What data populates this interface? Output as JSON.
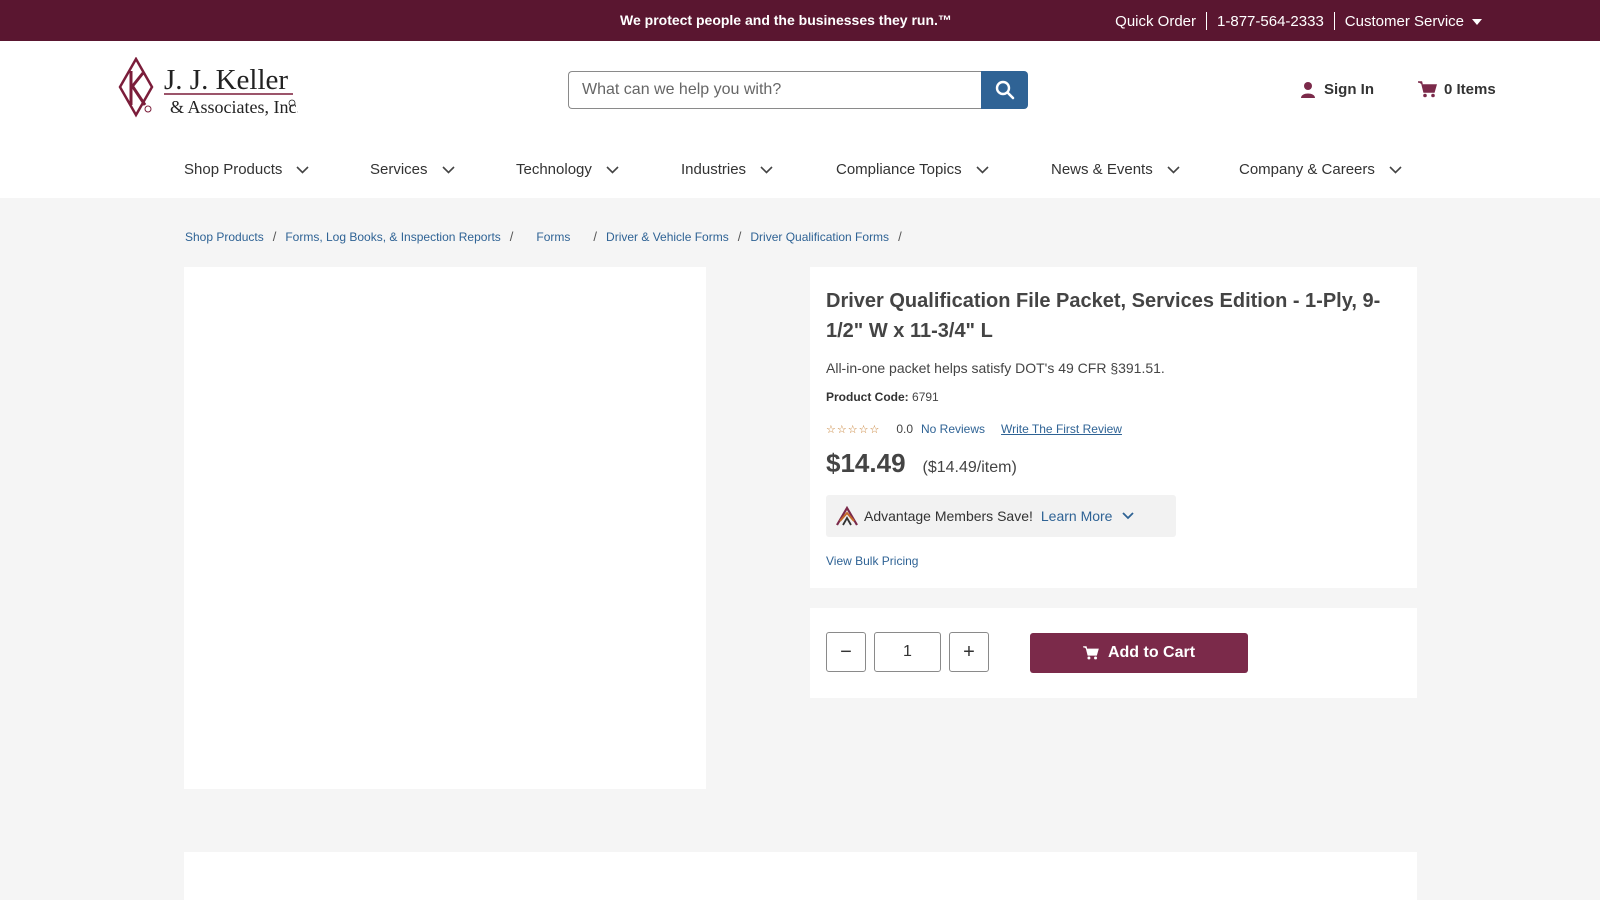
{
  "topbar": {
    "tagline": "We protect people and the businesses they run.™",
    "quick_order": "Quick Order",
    "phone": "1-877-564-2333",
    "customer_service": "Customer Service"
  },
  "header": {
    "logo_text_line1": "J. J. Keller",
    "logo_text_line2": "& Associates, Inc.",
    "search_placeholder": "What can we help you with?",
    "sign_in": "Sign In",
    "cart_items": "0 Items"
  },
  "nav": [
    {
      "label": "Shop Products"
    },
    {
      "label": "Services"
    },
    {
      "label": "Technology"
    },
    {
      "label": "Industries"
    },
    {
      "label": "Compliance Topics"
    },
    {
      "label": "News & Events"
    },
    {
      "label": "Company & Careers"
    }
  ],
  "breadcrumb": [
    "Shop Products",
    "Forms, Log Books, & Inspection Reports",
    "Forms",
    "Driver & Vehicle Forms",
    "Driver Qualification Forms"
  ],
  "product": {
    "title": "Driver Qualification File Packet, Services Edition - 1-Ply, 9-1/2\" W x 11-3/4\" L",
    "subtitle": "All-in-one packet helps satisfy DOT's 49 CFR §391.51.",
    "code_label": "Product Code:",
    "code_value": "6791",
    "rating_value": "0.0",
    "reviews_label": "No Reviews",
    "write_review": "Write The First Review",
    "price": "$14.49",
    "unit_price": "($14.49/item)",
    "advantage_text": "Advantage Members Save!",
    "learn_more": "Learn More",
    "bulk_pricing": "View Bulk Pricing"
  },
  "cart_form": {
    "quantity": "1",
    "minus": "−",
    "plus": "+",
    "add_to_cart": "Add to Cart"
  },
  "colors": {
    "brand": "#5a1630",
    "add_button": "#7b2a4a",
    "link": "#2f6395",
    "search_button": "#2f6395"
  }
}
